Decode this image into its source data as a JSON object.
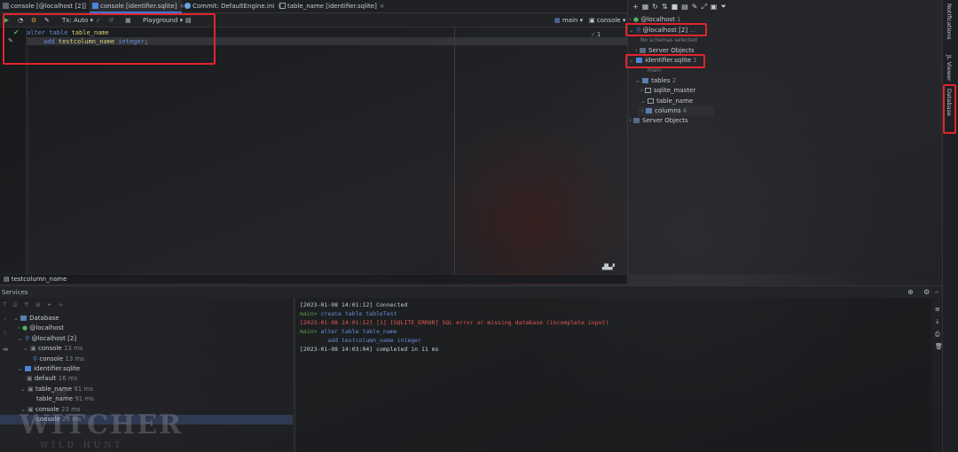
{
  "tabs": [
    {
      "label": "console [@localhost [2]]",
      "close": "×"
    },
    {
      "label": "console [identifier.sqlite]",
      "close": "×",
      "active": true
    },
    {
      "label": "Commit: DefaultEngine.ini",
      "close": "×"
    },
    {
      "label": "table_name [identifier.sqlite]",
      "close": "×"
    }
  ],
  "toolbar": {
    "tx": "Tx: Auto",
    "playground": "Playground",
    "branch": "main",
    "console": "console",
    "check_count": "1"
  },
  "editor": {
    "line1": {
      "kw1": "alter",
      "kw2": "table",
      "name": "table_name"
    },
    "line2": {
      "kw": "add",
      "name": "testcolumn_name",
      "type": "integer",
      "end": ";"
    }
  },
  "editor_status": "testcolumn_name",
  "database_panel": {
    "items": [
      {
        "label": "@localhost",
        "count": "1"
      },
      {
        "label": "@localhost [2]",
        "count": "…"
      },
      {
        "label": "No schemas selected"
      },
      {
        "label": "Server Objects"
      },
      {
        "label": "identifier.sqlite",
        "count": "1"
      },
      {
        "label": "main"
      },
      {
        "label": "tables",
        "count": "2"
      },
      {
        "label": "sqlite_master"
      },
      {
        "label": "table_name"
      },
      {
        "label": "columns",
        "count": "4"
      },
      {
        "label": "Server Objects"
      }
    ]
  },
  "side_tabs": {
    "notifications": "Notifications",
    "jl_viewer": "JL Viewer",
    "database": "Database"
  },
  "services": {
    "title": "Services",
    "tree": [
      {
        "label": "Database"
      },
      {
        "label": "@localhost"
      },
      {
        "label": "@localhost [2]"
      },
      {
        "label": "console",
        "time": "13 ms"
      },
      {
        "label": "console",
        "time": "13 ms"
      },
      {
        "label": "identifier.sqlite"
      },
      {
        "label": "default",
        "time": "16 ms"
      },
      {
        "label": "table_name",
        "time": "91 ms"
      },
      {
        "label": "table_name",
        "time": "91 ms"
      },
      {
        "label": "console",
        "time": "23 ms"
      },
      {
        "label": "console",
        "time": "23 ms"
      }
    ],
    "output": [
      {
        "text": "[2023-01-08 14:01:12] Connected"
      },
      {
        "prefix": "main>",
        "text": " create table tableTest"
      },
      {
        "text": "[2023-01-08 14:01:12] [1] [SQLITE_ERROR] SQL error or missing database (incomplete input)"
      },
      {
        "prefix": "main>",
        "text": " alter table table_name"
      },
      {
        "text": "        add testcolumn_name integer"
      },
      {
        "text": "[2023-01-08 14:03:04] completed in 11 ms"
      }
    ]
  },
  "watermark": {
    "top": "THE",
    "middle": "WITCHER",
    "bottom": "WILD HUNT"
  },
  "colors": {
    "highlight": "#e0252d",
    "accent": "#3d78d8",
    "error": "#e05a4f",
    "keyword": "#6b8cd6"
  }
}
